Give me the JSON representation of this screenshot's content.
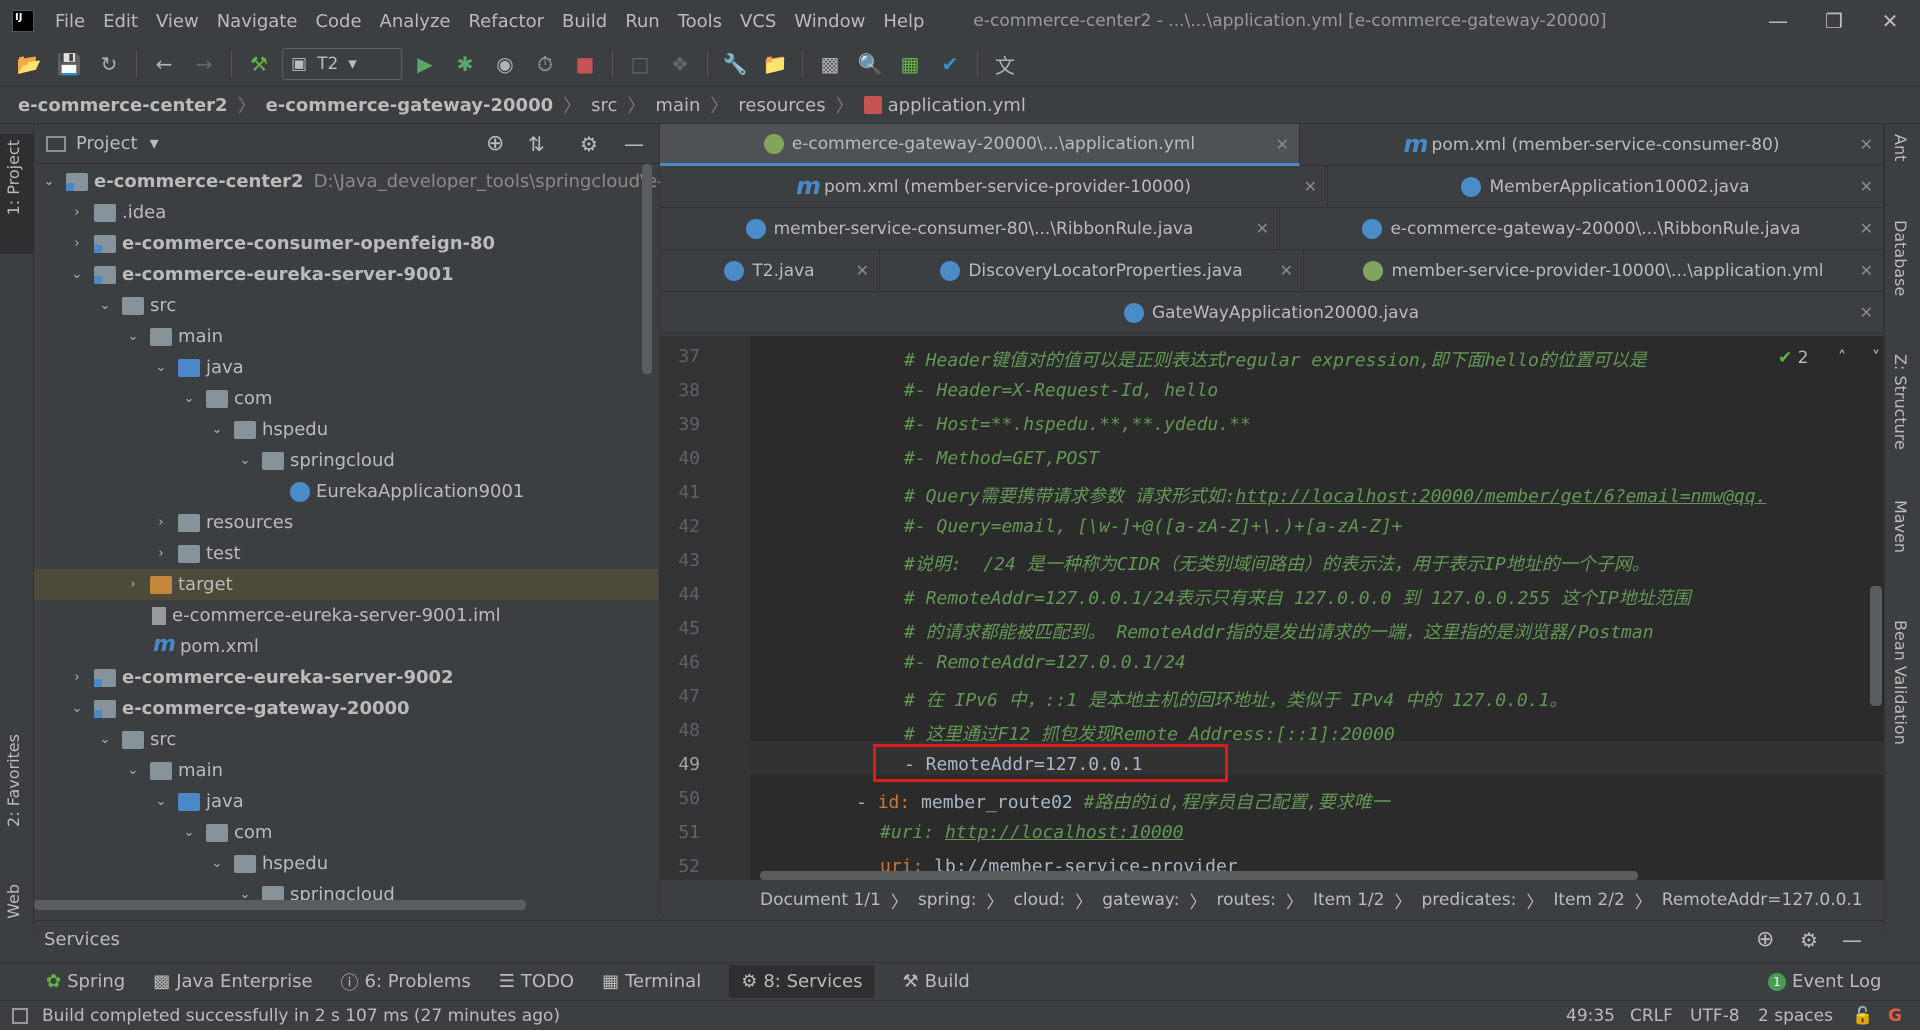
{
  "app": {
    "menu": [
      "File",
      "Edit",
      "View",
      "Navigate",
      "Code",
      "Analyze",
      "Refactor",
      "Build",
      "Run",
      "Tools",
      "VCS",
      "Window",
      "Help"
    ],
    "window_title": "e-commerce-center2 - ...\\...\\application.yml [e-commerce-gateway-20000]",
    "run_config": "T2"
  },
  "breadcrumb": [
    "e-commerce-center2",
    "e-commerce-gateway-20000",
    "src",
    "main",
    "resources",
    "application.yml"
  ],
  "project_panel": {
    "title": "Project",
    "tree": [
      {
        "label": "e-commerce-center2",
        "extra": "D:\\Java_developer_tools\\springcloud\\e-comm",
        "bold": true
      },
      {
        "label": ".idea"
      },
      {
        "label": "e-commerce-consumer-openfeign-80",
        "bold": true
      },
      {
        "label": "e-commerce-eureka-server-9001",
        "bold": true
      },
      {
        "label": "src"
      },
      {
        "label": "main"
      },
      {
        "label": "java"
      },
      {
        "label": "com"
      },
      {
        "label": "hspedu"
      },
      {
        "label": "springcloud"
      },
      {
        "label": "EurekaApplication9001"
      },
      {
        "label": "resources"
      },
      {
        "label": "test"
      },
      {
        "label": "target"
      },
      {
        "label": "e-commerce-eureka-server-9001.iml"
      },
      {
        "label": "pom.xml"
      },
      {
        "label": "e-commerce-eureka-server-9002",
        "bold": true
      },
      {
        "label": "e-commerce-gateway-20000",
        "bold": true
      },
      {
        "label": "src"
      },
      {
        "label": "main"
      },
      {
        "label": "java"
      },
      {
        "label": "com"
      },
      {
        "label": "hspedu"
      },
      {
        "label": "springcloud"
      }
    ]
  },
  "tabs": [
    {
      "label": "e-commerce-gateway-20000\\...\\application.yml",
      "active": true
    },
    {
      "label": "pom.xml (member-service-consumer-80)"
    },
    {
      "label": "pom.xml (member-service-provider-10000)"
    },
    {
      "label": "MemberApplication10002.java"
    },
    {
      "label": "member-service-consumer-80\\...\\RibbonRule.java"
    },
    {
      "label": "e-commerce-gateway-20000\\...\\RibbonRule.java"
    },
    {
      "label": "T2.java"
    },
    {
      "label": "DiscoveryLocatorProperties.java"
    },
    {
      "label": "member-service-provider-10000\\...\\application.yml"
    },
    {
      "label": "GateWayApplication20000.java"
    }
  ],
  "editor": {
    "line_numbers": [
      "37",
      "38",
      "39",
      "40",
      "41",
      "42",
      "43",
      "44",
      "45",
      "46",
      "47",
      "48",
      "49",
      "50",
      "51",
      "52"
    ],
    "lines": [
      "# Header键值对的值可以是正则表达式regular expression,即下面hello的位置可以是",
      "#- Header=X-Request-Id, hello",
      "#- Host=**.hspedu.**,**.ydedu.**",
      "#- Method=GET,POST",
      "# Query需要携带请求参数 请求形式如:",
      "#- Query=email, [\\w-]+@([a-zA-Z]+\\.)+[a-zA-Z]+",
      "#说明:  /24 是一种称为CIDR（无类别域间路由）的表示法，用于表示IP地址的一个子网。",
      "# RemoteAddr=127.0.0.1/24表示只有来自 127.0.0.0 到 127.0.0.255 这个IP地址范围",
      "# 的请求都能被匹配到。 RemoteAddr指的是发出请求的一端，这里指的是浏览器/Postman",
      "#- RemoteAddr=127.0.0.1/24",
      "# 在 IPv6 中，::1 是本地主机的回环地址，类似于 IPv4 中的 127.0.0.1。",
      "# 这里通过F12 抓包发现Remote Address:[::1]:20000",
      "- RemoteAddr=127.0.0.1",
      "- id: member_route02 #路由的id,程序员自己配置,要求唯一",
      "#uri: ",
      "uri: lb://member-service-provider"
    ],
    "link_41": "http://localhost:20000/member/get/6?email=nmw@qq.",
    "link_51": "http://localhost:10000",
    "line50_dash": "- ",
    "line50_key": "id:",
    "line50_value": " member_route02 ",
    "line50_comment": "#路由的id,程序员自己配置,要求唯一",
    "line52_key": "uri:",
    "line52_value": " lb://member-service-provider",
    "inspection_count": "2"
  },
  "editor_breadcrumb": [
    "Document 1/1",
    "spring:",
    "cloud:",
    "gateway:",
    "routes:",
    "Item 1/2",
    "predicates:",
    "Item 2/2",
    "RemoteAddr=127.0.0.1"
  ],
  "services_label": "Services",
  "tool_windows": [
    "Spring",
    "Java Enterprise",
    "6: Problems",
    "TODO",
    "Terminal",
    "8: Services",
    "Build"
  ],
  "event_log": "Event Log",
  "event_log_count": "1",
  "left_tabs": [
    "1: Project",
    "2: Favorites",
    "Web"
  ],
  "right_tabs": [
    "Ant",
    "Database",
    "Z: Structure",
    "Maven",
    "Bean Validation"
  ],
  "status": {
    "message": "Build completed successfully in 2 s 107 ms (27 minutes ago)",
    "position": "49:35",
    "line_sep": "CRLF",
    "encoding": "UTF-8",
    "indent": "2 spaces"
  }
}
